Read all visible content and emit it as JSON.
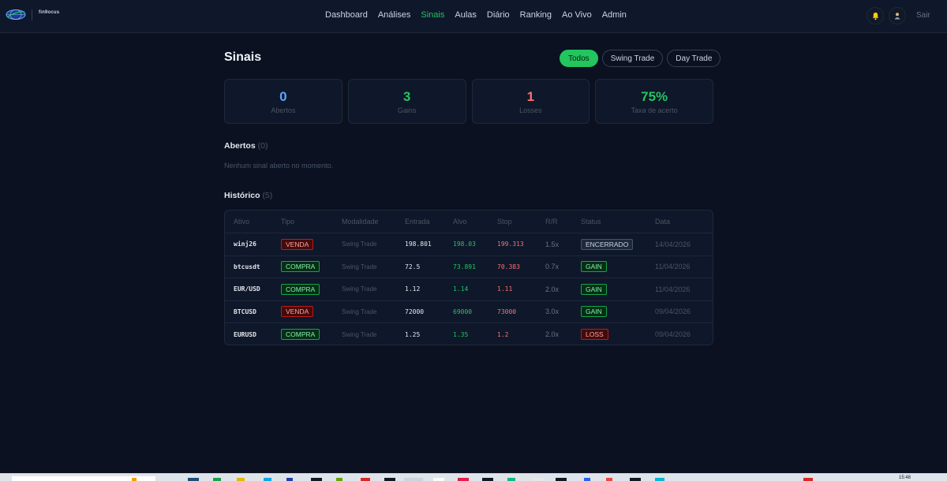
{
  "header": {
    "brand_text": "fin9ocus",
    "nav": [
      {
        "label": "Dashboard",
        "active": false
      },
      {
        "label": "Análises",
        "active": false
      },
      {
        "label": "Sinais",
        "active": true
      },
      {
        "label": "Aulas",
        "active": false
      },
      {
        "label": "Diário",
        "active": false
      },
      {
        "label": "Ranking",
        "active": false
      },
      {
        "label": "Ao Vivo",
        "active": false
      },
      {
        "label": "Admin",
        "active": false
      }
    ],
    "logout_label": "Sair"
  },
  "page": {
    "title": "Sinais",
    "filters": [
      {
        "label": "Todos",
        "active": true
      },
      {
        "label": "Swing Trade",
        "active": false
      },
      {
        "label": "Day Trade",
        "active": false
      }
    ]
  },
  "stats": [
    {
      "value": "0",
      "label": "Abertos",
      "color": "#60a5fa"
    },
    {
      "value": "3",
      "label": "Gains",
      "color": "#22c55e"
    },
    {
      "value": "1",
      "label": "Losses",
      "color": "#f87171"
    },
    {
      "value": "75%",
      "label": "Taxa de acerto",
      "color": "#22c55e"
    }
  ],
  "abertos": {
    "heading": "Abertos",
    "count": "(0)",
    "empty_text": "Nenhum sinal aberto no momento."
  },
  "historico": {
    "heading": "Histórico",
    "count": "(5)",
    "columns": [
      "Ativo",
      "Tipo",
      "Modalidade",
      "Entrada",
      "Alvo",
      "Stop",
      "R/R",
      "Status",
      "Data"
    ],
    "rows": [
      {
        "ativo": "winj26",
        "tipo": "VENDA",
        "modalidade": "Swing Trade",
        "entrada": "198.801",
        "alvo": "198.03",
        "stop": "199.313",
        "rr": "1.5x",
        "status": "ENCERRADO",
        "data": "14/04/2026"
      },
      {
        "ativo": "btcusdt",
        "tipo": "COMPRA",
        "modalidade": "Swing Trade",
        "entrada": "72.5",
        "alvo": "73.891",
        "stop": "70.383",
        "rr": "0.7x",
        "status": "GAIN",
        "data": "11/04/2026"
      },
      {
        "ativo": "EUR/USD",
        "tipo": "COMPRA",
        "modalidade": "Swing Trade",
        "entrada": "1.12",
        "alvo": "1.14",
        "stop": "1.11",
        "rr": "2.0x",
        "status": "GAIN",
        "data": "11/04/2026"
      },
      {
        "ativo": "BTCUSD",
        "tipo": "VENDA",
        "modalidade": "Swing Trade",
        "entrada": "72000",
        "alvo": "69000",
        "stop": "73000",
        "rr": "3.0x",
        "status": "GAIN",
        "data": "09/04/2026"
      },
      {
        "ativo": "EURUSD",
        "tipo": "COMPRA",
        "modalidade": "Swing Trade",
        "entrada": "1.25",
        "alvo": "1.35",
        "stop": "1.2",
        "rr": "2.0x",
        "status": "LOSS",
        "data": "09/04/2026"
      }
    ]
  },
  "taskbar": {
    "clock": "15:48"
  }
}
